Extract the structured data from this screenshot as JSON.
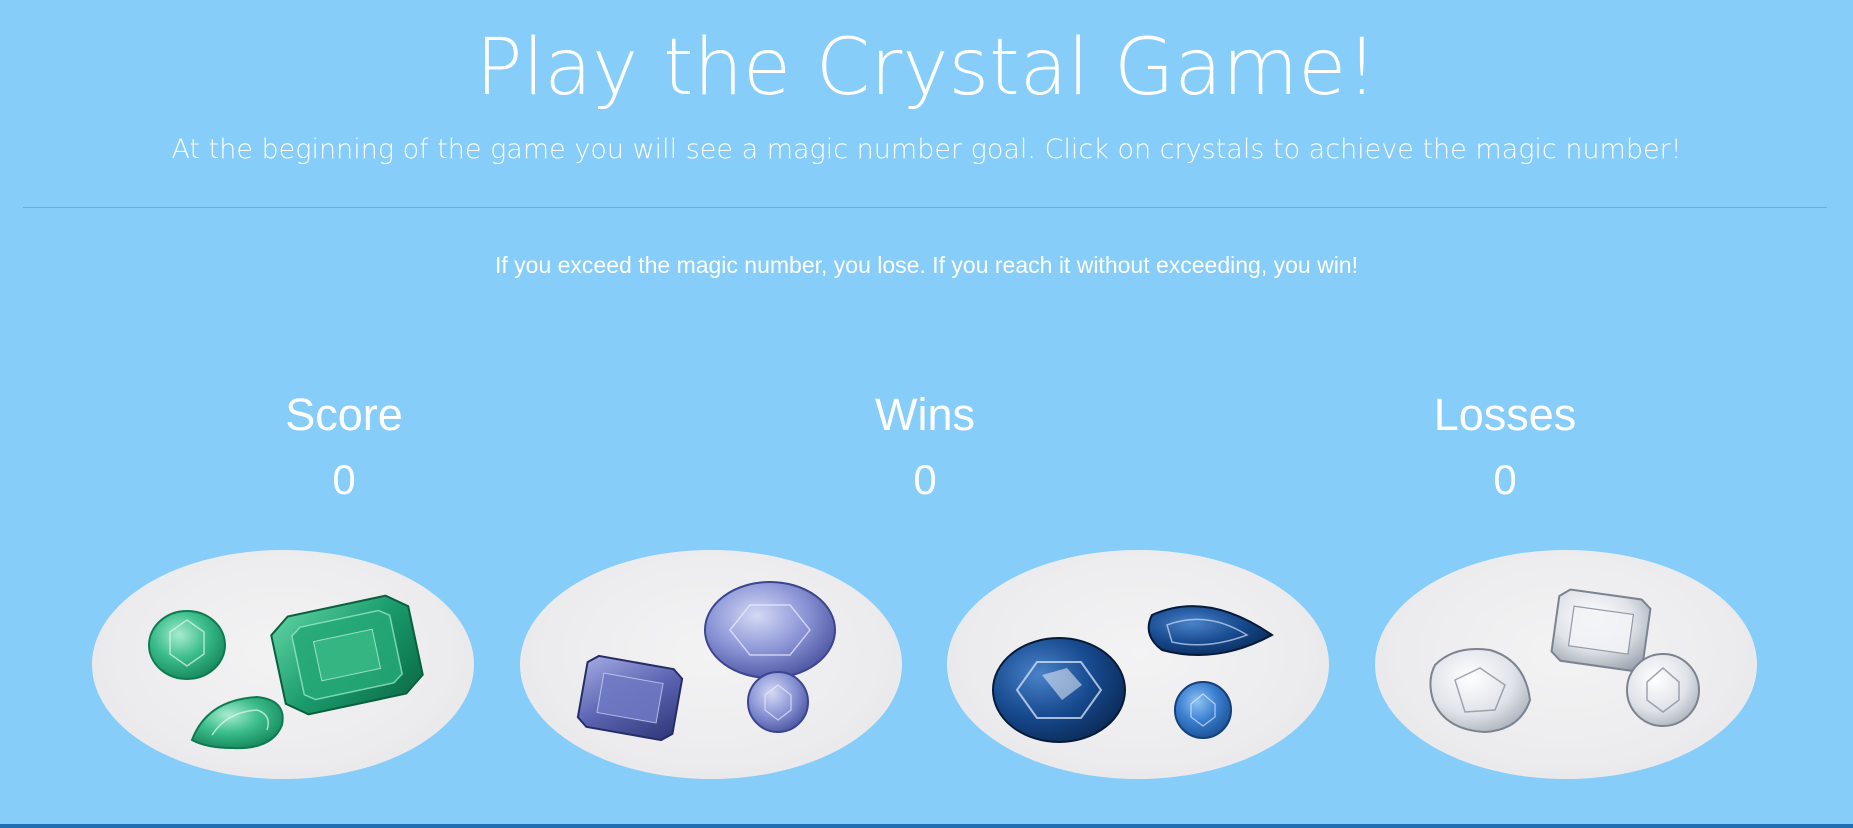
{
  "header": {
    "title": "Play the Crystal Game!",
    "instructions": "At the beginning of the game you will see a magic number goal. Click on crystals to achieve the magic number!"
  },
  "rules": "If you exceed the magic number, you lose. If you reach it without exceeding, you win!",
  "stats": {
    "score_label": "Score",
    "score_value": "0",
    "wins_label": "Wins",
    "wins_value": "0",
    "losses_label": "Losses",
    "losses_value": "0"
  },
  "crystals": [
    {
      "name": "emerald",
      "colors": [
        "#1a9b6c",
        "#4cc796",
        "#0f7a52"
      ]
    },
    {
      "name": "iolite",
      "colors": [
        "#5d67b3",
        "#9aa4de",
        "#3b4590"
      ]
    },
    {
      "name": "sapphire",
      "colors": [
        "#123d7a",
        "#3a73bd",
        "#0a2752"
      ]
    },
    {
      "name": "clear-quartz",
      "colors": [
        "#d9dce2",
        "#ffffff",
        "#a9afba"
      ]
    }
  ],
  "colors": {
    "background": "#87cdf9",
    "divider": "#6aaee0",
    "crystal_plate": "#ececee",
    "bottom_bar": "#1f6fb2"
  }
}
